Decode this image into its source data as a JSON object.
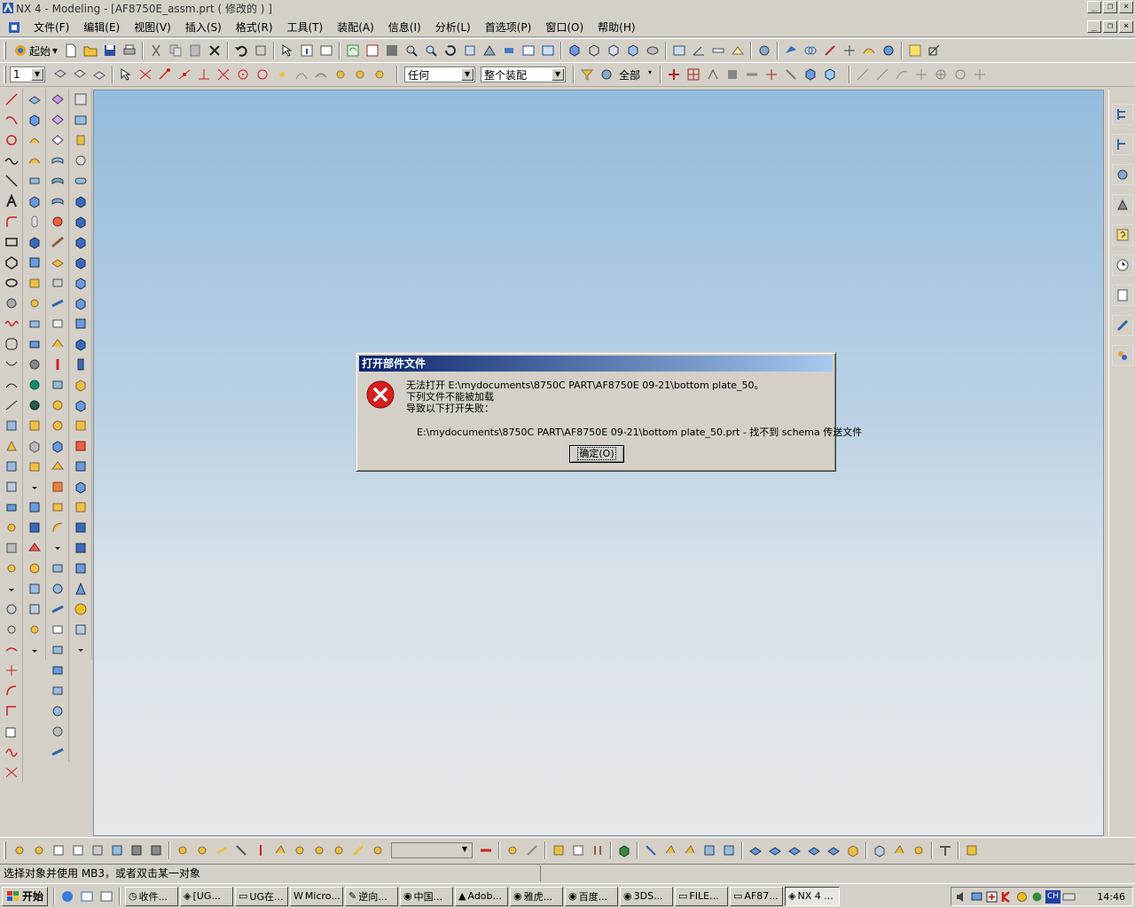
{
  "window": {
    "title": "NX 4 - Modeling - [AF8750E_assm.prt ( 修改的 ) ]"
  },
  "menus": [
    "文件(F)",
    "编辑(E)",
    "视图(V)",
    "插入(S)",
    "格式(R)",
    "工具(T)",
    "装配(A)",
    "信息(I)",
    "分析(L)",
    "首选项(P)",
    "窗口(O)",
    "帮助(H)"
  ],
  "toolbar1": {
    "start_label": "起始"
  },
  "toolbar2": {
    "layer_value": "1",
    "filter_value": "任何",
    "scope_value": "整个装配",
    "selection_value": "全部"
  },
  "dialog": {
    "title": "打开部件文件",
    "line1": "无法打开 E:\\mydocuments\\8750C PART\\AF8750E 09-21\\bottom plate_50。",
    "line2": "下列文件不能被加载",
    "line3": "导致以下打开失败：",
    "detail": "E:\\mydocuments\\8750C PART\\AF8750E 09-21\\bottom plate_50.prt - 找不到 schema 传送文件",
    "ok_label": "确定(O)"
  },
  "status": {
    "text": "选择对象并使用 MB3，或者双击某一对象"
  },
  "taskbar": {
    "start_label": "开始",
    "tasks": [
      "收件...",
      "[UG...",
      "UG在...",
      "Micro...",
      "逆向...",
      "中国...",
      "Adob...",
      "雅虎...",
      "百度...",
      "3DS...",
      "FILE...",
      "AF87...",
      "NX 4 ..."
    ],
    "clock": "14:46",
    "lang": "CH"
  },
  "colors": {
    "dialog_title_start": "#0a246a",
    "dialog_title_end": "#a6caf0",
    "error_red": "#d81e1e"
  }
}
